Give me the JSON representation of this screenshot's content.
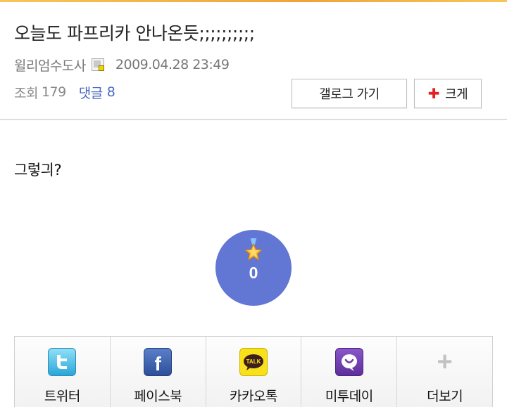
{
  "post": {
    "title": "오늘도 파프리카 안나온듯;;;;;;;;;;",
    "author": "윌리엄수도사",
    "date": "2009.04.28 23:49",
    "views_label": "조회",
    "views": "179",
    "comments_label": "댓글",
    "comments": "8",
    "body": "그렇긔?"
  },
  "buttons": {
    "gallery_label": "갤로그 가기",
    "zoom_label": "크게"
  },
  "recommend": {
    "count": "0",
    "icon": "star-medal-icon"
  },
  "share": [
    {
      "label": "트위터",
      "icon": "twitter-icon"
    },
    {
      "label": "페이스북",
      "icon": "facebook-icon"
    },
    {
      "label": "카카오톡",
      "icon": "kakaotalk-icon"
    },
    {
      "label": "미투데이",
      "icon": "me2day-icon"
    },
    {
      "label": "더보기",
      "icon": "plus-icon"
    }
  ],
  "colors": {
    "accent_bar": "#f1a33b",
    "recommend_circle": "#6276d4",
    "comment_link": "#4a6bc4",
    "zoom_plus": "#e02424"
  }
}
